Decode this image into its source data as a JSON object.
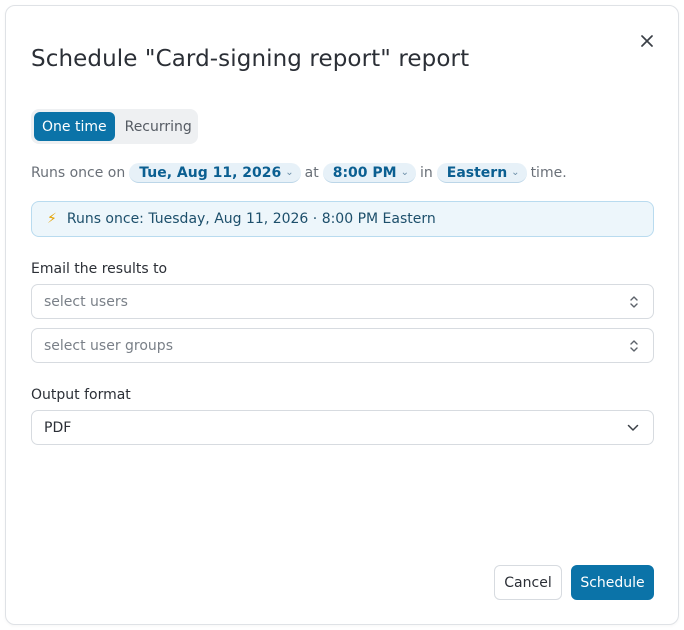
{
  "dialog": {
    "title": "Schedule \"Card-signing report\" report",
    "close_icon": "close-icon"
  },
  "frequency": {
    "options": [
      "One time",
      "Recurring"
    ],
    "selected": "One time"
  },
  "runs_line": {
    "prefix": "Runs once on",
    "date": "Tue, Aug 11, 2026",
    "at": "at",
    "time": "8:00 PM",
    "in": "in",
    "timezone": "Eastern",
    "suffix": "time."
  },
  "banner": {
    "icon": "lightning-icon",
    "text": "Runs once: Tuesday, Aug 11, 2026 · 8:00 PM Eastern"
  },
  "email": {
    "label": "Email the results to",
    "users_placeholder": "select users",
    "groups_placeholder": "select user groups"
  },
  "output": {
    "label": "Output format",
    "value": "PDF"
  },
  "footer": {
    "cancel": "Cancel",
    "schedule": "Schedule"
  },
  "colors": {
    "accent": "#0b73a8",
    "banner_bg": "#edf6fb",
    "pill_bg": "#e7f1f8"
  }
}
